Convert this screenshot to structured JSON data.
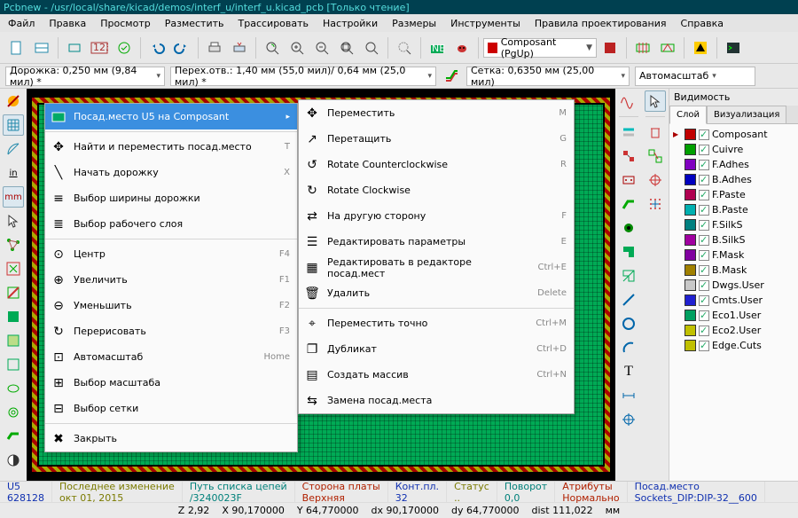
{
  "title": "Pcbnew - /usr/local/share/kicad/demos/interf_u/interf_u.kicad_pcb [Только чтение]",
  "menubar": [
    "Файл",
    "Правка",
    "Просмотр",
    "Разместить",
    "Трассировать",
    "Настройки",
    "Размеры",
    "Инструменты",
    "Правила проектирования",
    "Справка"
  ],
  "toolbar2": {
    "track": "Дорожка: 0,250 мм (9,84 мил) *",
    "via": "Перех.отв.: 1,40 мм (55,0 мил)/ 0,64 мм (25,0 мил) *",
    "grid": "Сетка: 0,6350 мм (25,00 мил)",
    "zoom": "Автомасштаб"
  },
  "layer_combo": "Composant (PgUp)",
  "vis": {
    "title": "Видимость",
    "tabs": [
      "Слой",
      "Визуализация"
    ]
  },
  "layers": [
    {
      "name": "Composant",
      "color": "#c00000",
      "arrow": true
    },
    {
      "name": "Cuivre",
      "color": "#00a000"
    },
    {
      "name": "F.Adhes",
      "color": "#8000c0"
    },
    {
      "name": "B.Adhes",
      "color": "#0000c0"
    },
    {
      "name": "F.Paste",
      "color": "#b00050"
    },
    {
      "name": "B.Paste",
      "color": "#00b0b0"
    },
    {
      "name": "F.SilkS",
      "color": "#008080"
    },
    {
      "name": "B.SilkS",
      "color": "#a000a0"
    },
    {
      "name": "F.Mask",
      "color": "#8000a0"
    },
    {
      "name": "B.Mask",
      "color": "#a08000"
    },
    {
      "name": "Dwgs.User",
      "color": "#c8c8c8"
    },
    {
      "name": "Cmts.User",
      "color": "#2020d0"
    },
    {
      "name": "Eco1.User",
      "color": "#00a060"
    },
    {
      "name": "Eco2.User",
      "color": "#c0c000"
    },
    {
      "name": "Edge.Cuts",
      "color": "#c0c000"
    }
  ],
  "ctx1": {
    "header": "Посад.место U5 на Composant",
    "items": [
      {
        "label": "Найти и переместить посад.место",
        "sc": "T"
      },
      {
        "label": "Начать дорожку",
        "sc": "X"
      },
      {
        "label": "Выбор ширины дорожки"
      },
      {
        "label": "Выбор рабочего слоя"
      },
      {
        "sep": true
      },
      {
        "label": "Центр",
        "sc": "F4"
      },
      {
        "label": "Увеличить",
        "sc": "F1"
      },
      {
        "label": "Уменьшить",
        "sc": "F2"
      },
      {
        "label": "Перерисовать",
        "sc": "F3"
      },
      {
        "label": "Автомасштаб",
        "sc": "Home"
      },
      {
        "label": "Выбор масштаба"
      },
      {
        "label": "Выбор сетки"
      },
      {
        "sep": true
      },
      {
        "label": "Закрыть"
      }
    ]
  },
  "ctx2": [
    {
      "label": "Переместить",
      "sc": "M"
    },
    {
      "label": "Перетащить",
      "sc": "G"
    },
    {
      "label": "Rotate Counterclockwise",
      "sc": "R"
    },
    {
      "label": "Rotate Clockwise"
    },
    {
      "label": "На другую сторону",
      "sc": "F"
    },
    {
      "label": "Редактировать параметры",
      "sc": "E"
    },
    {
      "label": "Редактировать в редакторе посад.мест",
      "sc": "Ctrl+E"
    },
    {
      "label": "Удалить",
      "sc": "Delete"
    },
    {
      "sep": true
    },
    {
      "label": "Переместить точно",
      "sc": "Ctrl+M"
    },
    {
      "label": "Дубликат",
      "sc": "Ctrl+D"
    },
    {
      "label": "Создать массив",
      "sc": "Ctrl+N"
    },
    {
      "label": "Замена посад.места"
    }
  ],
  "status1": [
    {
      "l1": "U5",
      "l2": "628128",
      "c": "#1030b0"
    },
    {
      "l1": "Последнее изменение",
      "l2": "окт 01, 2015",
      "c": "#7a7a00"
    },
    {
      "l1": "Путь списка цепей",
      "l2": "/3240023F",
      "c": "#00807a"
    },
    {
      "l1": "Сторона платы",
      "l2": "Верхняя",
      "c": "#b02000"
    },
    {
      "l1": "Конт.пл.",
      "l2": "32",
      "c": "#1030b0"
    },
    {
      "l1": "Статус",
      "l2": "..",
      "c": "#7a7a00"
    },
    {
      "l1": "Поворот",
      "l2": "0,0",
      "c": "#00807a"
    },
    {
      "l1": "Атрибуты",
      "l2": "Нормально",
      "c": "#b02000"
    },
    {
      "l1": "Посад.место",
      "l2": "Sockets_DIP:DIP-32__600",
      "c": "#1030b0"
    }
  ],
  "status2": {
    "z": "Z 2,92",
    "x": "X 90,170000",
    "y": "Y 64,770000",
    "dx": "dx 90,170000",
    "dy": "dy 64,770000",
    "dist": "dist 111,022",
    "unit": "мм"
  }
}
